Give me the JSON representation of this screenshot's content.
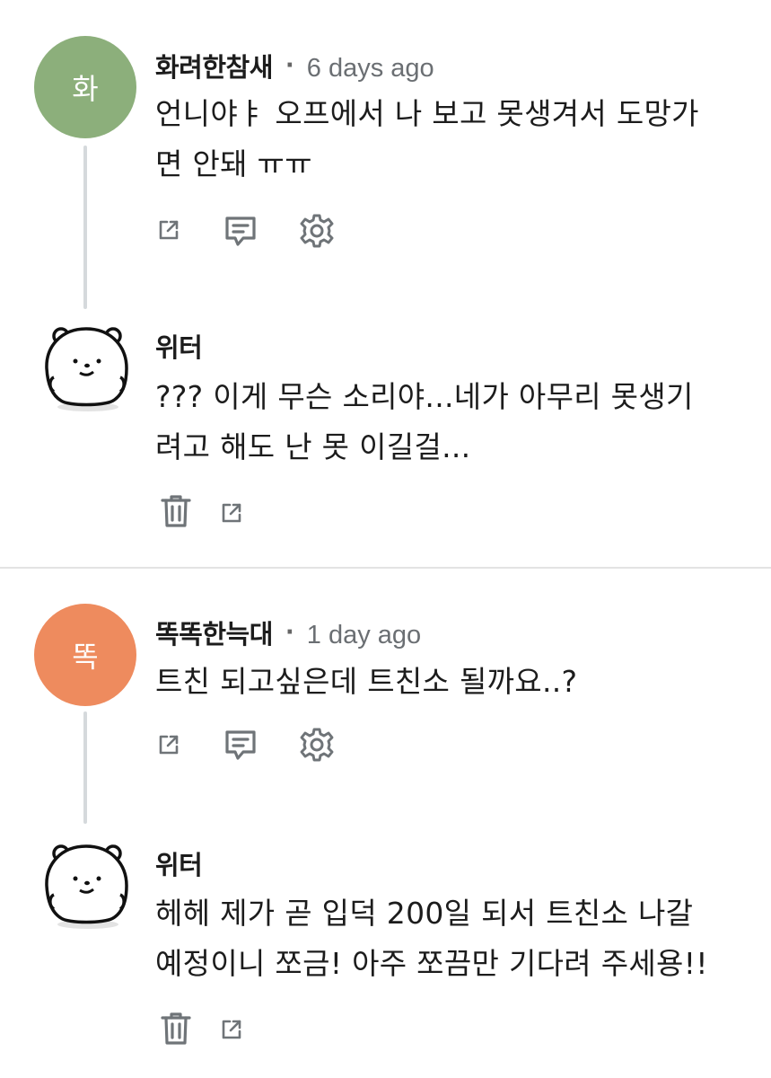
{
  "threads": [
    {
      "comment": {
        "avatar_letter": "화",
        "avatar_color": "#8caf7b",
        "username": "화려한참새",
        "separator": "·",
        "timestamp": "6 days ago",
        "text_lines": [
          "언니야ㅑ 오프에서 나 보고 못생겨서 도망가",
          "면 안돼 ㅠㅠ"
        ],
        "actions": [
          "share-icon",
          "reply-icon",
          "settings-icon"
        ]
      },
      "reply": {
        "username": "위터",
        "text_lines": [
          "??? 이게 무슨 소리야...네가 아무리 못생기",
          "려고 해도 난 못 이길걸..."
        ],
        "actions": [
          "delete-icon",
          "share-icon"
        ]
      }
    },
    {
      "comment": {
        "avatar_letter": "똑",
        "avatar_color": "#ee8b5e",
        "username": "똑똑한늑대",
        "separator": "·",
        "timestamp": "1 day ago",
        "text_lines": [
          "트친 되고싶은데 트친소 될까요..?"
        ],
        "actions": [
          "share-icon",
          "reply-icon",
          "settings-icon"
        ]
      },
      "reply": {
        "username": "위터",
        "text_lines": [
          "헤헤 제가 곧 입덕 200일 되서 트친소 나갈",
          "예정이니 쪼금! 아주 쪼끔만 기다려 주세용!!"
        ],
        "actions": [
          "delete-icon",
          "share-icon"
        ]
      }
    }
  ]
}
